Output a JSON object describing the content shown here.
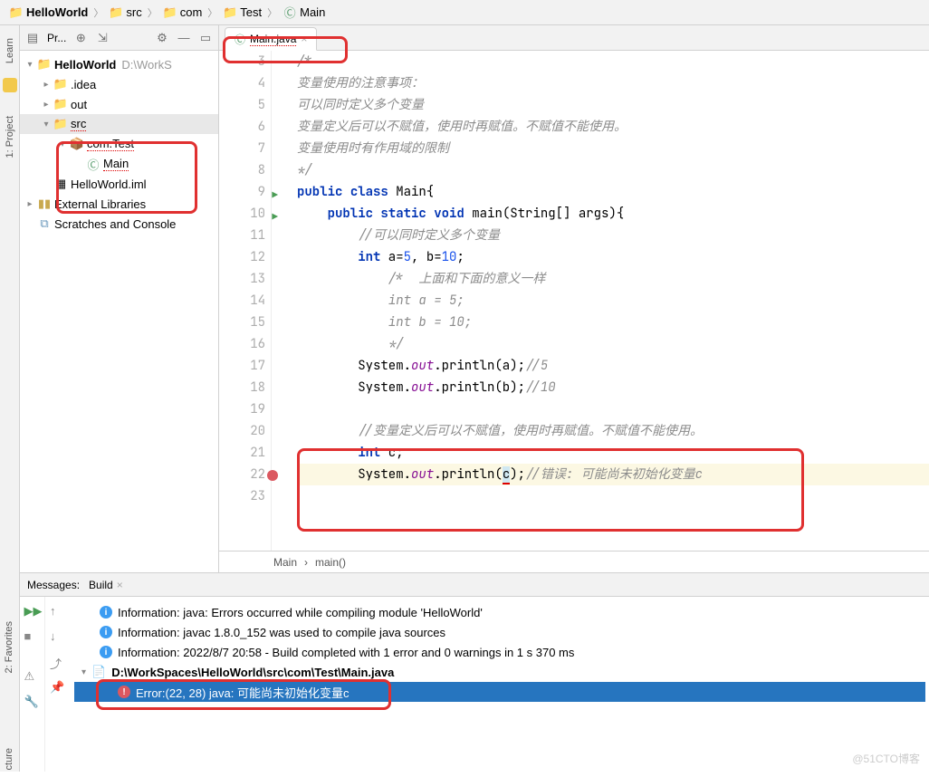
{
  "breadcrumb": [
    {
      "icon": "project",
      "label": "HelloWorld",
      "bold": true
    },
    {
      "icon": "folder",
      "label": "src"
    },
    {
      "icon": "folder",
      "label": "com"
    },
    {
      "icon": "folder",
      "label": "Test"
    },
    {
      "icon": "class",
      "label": "Main"
    }
  ],
  "sideTabs": {
    "learn": "Learn",
    "project": "1: Project",
    "favorites": "2: Favorites",
    "structure": "cture"
  },
  "projectPane": {
    "title": "Pr...",
    "root": {
      "label": "HelloWorld",
      "path": "D:\\WorkS"
    },
    "idea": ".idea",
    "out": "out",
    "src": "src",
    "pkg": "com.Test",
    "mainClass": "Main",
    "iml": "HelloWorld.iml",
    "extLib": "External Libraries",
    "scratches": "Scratches and Console"
  },
  "editor": {
    "tabName": "Main.java",
    "lines": [
      {
        "n": 3,
        "html": "<span class='cmt'>/*</span>"
      },
      {
        "n": 4,
        "html": "<span class='cmt'>变量使用的注意事项：</span>"
      },
      {
        "n": 5,
        "html": "<span class='cmt'>可以同时定义多个变量</span>"
      },
      {
        "n": 6,
        "html": "<span class='cmt'>变量定义后可以不赋值，使用时再赋值。不赋值不能使用。</span>"
      },
      {
        "n": 7,
        "html": "<span class='cmt'>变量使用时有作用域的限制</span>"
      },
      {
        "n": 8,
        "html": "<span class='cmt'>*/</span>"
      },
      {
        "n": 9,
        "run": true,
        "html": "<span class='kw'>public</span> <span class='kw'>class</span> Main{"
      },
      {
        "n": 10,
        "run": true,
        "html": "    <span class='kw'>public</span> <span class='kw'>static</span> <span class='kw'>void</span> main(String[] args){"
      },
      {
        "n": 11,
        "html": "        <span class='cmt'>//可以同时定义多个变量</span>"
      },
      {
        "n": 12,
        "html": "        <span class='kw'>int</span> a=<span class='num'>5</span>, b=<span class='num'>10</span>;"
      },
      {
        "n": 13,
        "html": "            <span class='cmt'>/*  上面和下面的意义一样</span>"
      },
      {
        "n": 14,
        "html": "            <span class='cmt'>int a = 5;</span>"
      },
      {
        "n": 15,
        "html": "            <span class='cmt'>int b = 10;</span>"
      },
      {
        "n": 16,
        "html": "            <span class='cmt'>*/</span>"
      },
      {
        "n": 17,
        "html": "        System.<span class='fld'>out</span>.println(a);<span class='cmt'>//5</span>"
      },
      {
        "n": 18,
        "html": "        System.<span class='fld'>out</span>.println(b);<span class='cmt'>//10</span>"
      },
      {
        "n": 19,
        "html": ""
      },
      {
        "n": 20,
        "html": "        <span class='cmt'>//变量定义后可以不赋值，使用时再赋值。不赋值不能使用。</span>"
      },
      {
        "n": 21,
        "html": "        <span class='kw'>int</span> c;"
      },
      {
        "n": 22,
        "bulb": true,
        "hl": true,
        "html": "        System.<span class='fld'>out</span>.println(<span class='err-sq'>c</span>);<span class='cmt'>//错误: 可能尚未初始化变量c</span>"
      },
      {
        "n": 23,
        "html": ""
      }
    ],
    "crumbClass": "Main",
    "crumbMethod": "main()"
  },
  "messages": {
    "title": "Messages:",
    "tab": "Build",
    "rows": [
      {
        "type": "info",
        "indent": 1,
        "text": "Information: java: Errors occurred while compiling module 'HelloWorld'"
      },
      {
        "type": "info",
        "indent": 1,
        "text": "Information: javac 1.8.0_152 was used to compile java sources"
      },
      {
        "type": "info",
        "indent": 1,
        "text": "Information: 2022/8/7 20:58 - Build completed with 1 error and 0 warnings in 1 s 370 ms"
      },
      {
        "type": "file",
        "indent": 0,
        "text": "D:\\WorkSpaces\\HelloWorld\\src\\com\\Test\\Main.java"
      },
      {
        "type": "error",
        "indent": 2,
        "selected": true,
        "text": "Error:(22, 28)  java: 可能尚未初始化变量c"
      }
    ]
  },
  "watermark": "@51CTO博客"
}
